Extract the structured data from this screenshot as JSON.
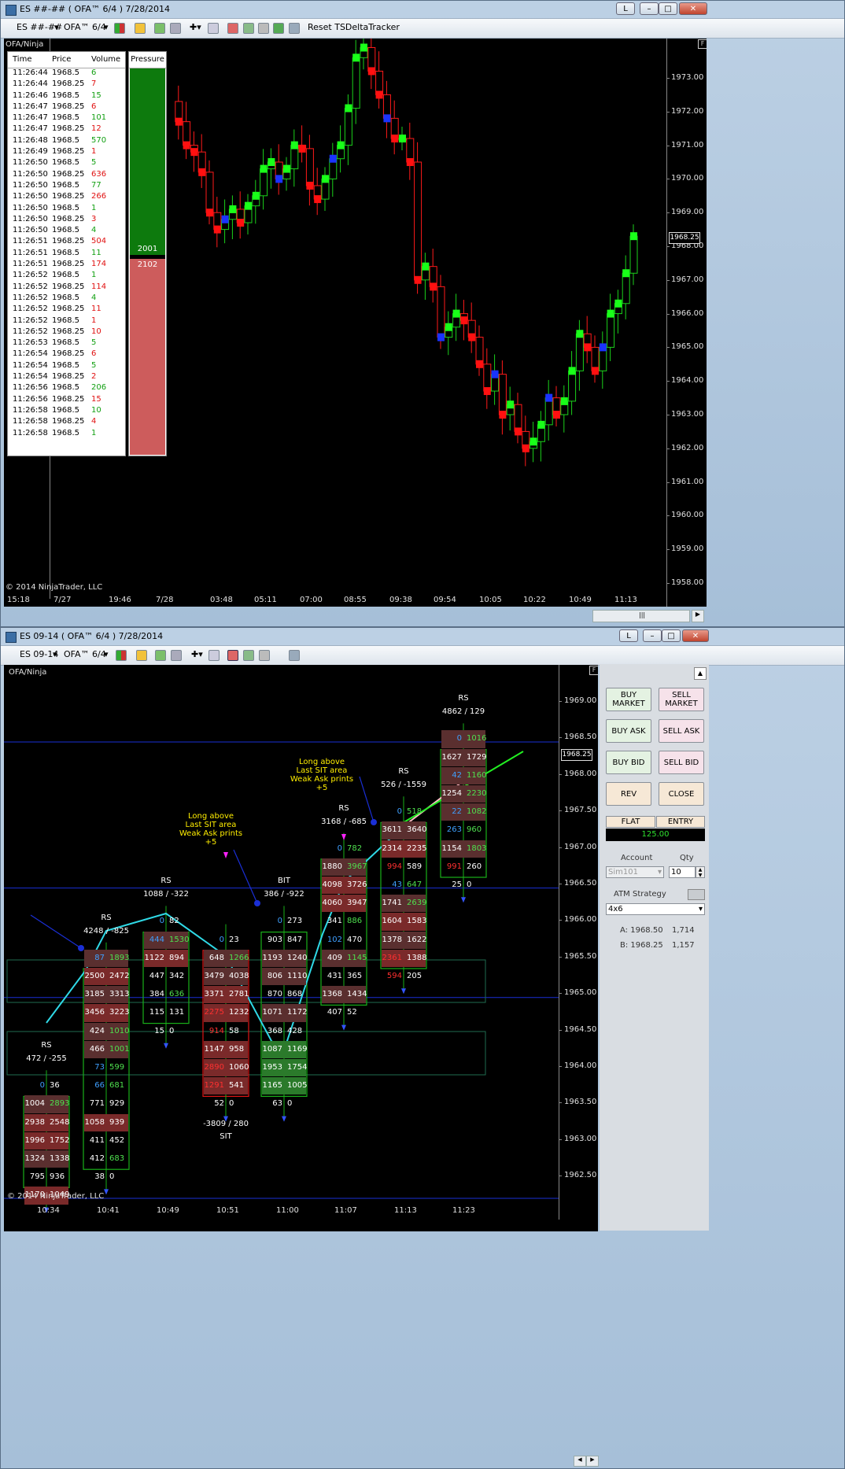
{
  "top_window": {
    "title": "ES ##-## ( OFA™ 6/4 )  7/28/2014",
    "instrument": "ES ##-##",
    "template": "OFA™ 6/4",
    "reset_label": "Reset TSDeltaTracker",
    "chart_label": "OFA/Ninja",
    "copyright": "© 2014 NinjaTrader, LLC",
    "price_marker": "1968.25",
    "f_label": "F",
    "l_label": "L",
    "tape": {
      "headers": [
        "Time",
        "Price",
        "Volume"
      ],
      "rows": [
        [
          "11:26:44",
          "1968.5",
          "6",
          "g"
        ],
        [
          "11:26:44",
          "1968.25",
          "7",
          "r"
        ],
        [
          "11:26:46",
          "1968.5",
          "15",
          "g"
        ],
        [
          "11:26:47",
          "1968.25",
          "6",
          "r"
        ],
        [
          "11:26:47",
          "1968.5",
          "101",
          "g"
        ],
        [
          "11:26:47",
          "1968.25",
          "12",
          "r"
        ],
        [
          "11:26:48",
          "1968.5",
          "570",
          "g"
        ],
        [
          "11:26:49",
          "1968.25",
          "1",
          "r"
        ],
        [
          "11:26:50",
          "1968.5",
          "5",
          "g"
        ],
        [
          "11:26:50",
          "1968.25",
          "636",
          "r"
        ],
        [
          "11:26:50",
          "1968.5",
          "77",
          "g"
        ],
        [
          "11:26:50",
          "1968.25",
          "266",
          "r"
        ],
        [
          "11:26:50",
          "1968.5",
          "1",
          "g"
        ],
        [
          "11:26:50",
          "1968.25",
          "3",
          "r"
        ],
        [
          "11:26:50",
          "1968.5",
          "4",
          "g"
        ],
        [
          "11:26:51",
          "1968.25",
          "504",
          "r"
        ],
        [
          "11:26:51",
          "1968.5",
          "11",
          "g"
        ],
        [
          "11:26:51",
          "1968.25",
          "174",
          "r"
        ],
        [
          "11:26:52",
          "1968.5",
          "1",
          "g"
        ],
        [
          "11:26:52",
          "1968.25",
          "114",
          "r"
        ],
        [
          "11:26:52",
          "1968.5",
          "4",
          "g"
        ],
        [
          "11:26:52",
          "1968.25",
          "11",
          "r"
        ],
        [
          "11:26:52",
          "1968.5",
          "1",
          "r"
        ],
        [
          "11:26:52",
          "1968.25",
          "10",
          "r"
        ],
        [
          "11:26:53",
          "1968.5",
          "5",
          "g"
        ],
        [
          "11:26:54",
          "1968.25",
          "6",
          "r"
        ],
        [
          "11:26:54",
          "1968.5",
          "5",
          "g"
        ],
        [
          "11:26:54",
          "1968.25",
          "2",
          "r"
        ],
        [
          "11:26:56",
          "1968.5",
          "206",
          "g"
        ],
        [
          "11:26:56",
          "1968.25",
          "15",
          "r"
        ],
        [
          "11:26:58",
          "1968.5",
          "10",
          "g"
        ],
        [
          "11:26:58",
          "1968.25",
          "4",
          "r"
        ],
        [
          "11:26:58",
          "1968.5",
          "1",
          "g"
        ]
      ]
    },
    "pressure": {
      "title": "Pressure",
      "buy": "2001",
      "sell": "2102",
      "buy_fraction": 0.488
    },
    "y_ticks": [
      "1973.00",
      "1972.00",
      "1971.00",
      "1970.00",
      "1969.00",
      "1968.00",
      "1967.00",
      "1966.00",
      "1965.00",
      "1964.00",
      "1963.00",
      "1962.00",
      "1961.00",
      "1960.00",
      "1959.00",
      "1958.00"
    ],
    "x_ticks": [
      "15:18",
      "7/27",
      "19:46",
      "7/28",
      "03:48",
      "05:11",
      "07:00",
      "08:55",
      "09:38",
      "09:54",
      "10:05",
      "10:22",
      "10:49",
      "11:13"
    ]
  },
  "bottom_window": {
    "title": "ES 09-14 ( OFA™ 6/4 )  7/28/2014",
    "instrument": "ES 09-14",
    "template": "OFA™ 6/4",
    "chart_label": "OFA/Ninja",
    "copyright": "© 2014 NinjaTrader, LLC",
    "price_marker": "1968.25",
    "f_label": "F",
    "l_label": "L",
    "y_ticks": [
      "1969.00",
      "1968.50",
      "1968.00",
      "1967.50",
      "1967.00",
      "1966.50",
      "1966.00",
      "1965.50",
      "1965.00",
      "1964.50",
      "1964.00",
      "1963.50",
      "1963.00",
      "1962.50"
    ],
    "x_ticks": [
      "10:34",
      "10:41",
      "10:49",
      "10:51",
      "11:00",
      "11:07",
      "11:13",
      "11:23"
    ],
    "annotations": [
      {
        "lines": [
          "Long above",
          "Last SIT area",
          "Weak Ask prints",
          "+5"
        ]
      },
      {
        "lines": [
          "Long above",
          "Last SIT area",
          "Weak Ask prints",
          "+5"
        ]
      }
    ],
    "bars": [
      {
        "tag": "RS",
        "delta": "472 / -255",
        "rows": [
          [
            "0",
            "36"
          ],
          [
            "1004",
            "2893"
          ],
          [
            "2938",
            "2548"
          ],
          [
            "1996",
            "1752"
          ],
          [
            "1324",
            "1338"
          ],
          [
            "795",
            "936"
          ],
          [
            "1170",
            "1049"
          ]
        ]
      },
      {
        "tag": "RS",
        "delta": "4248 / -825",
        "rows": [
          [
            "87",
            "1893"
          ],
          [
            "2500",
            "2472"
          ],
          [
            "3185",
            "3313"
          ],
          [
            "3456",
            "3223"
          ],
          [
            "424",
            "1010"
          ],
          [
            "466",
            "1001"
          ],
          [
            "73",
            "599"
          ],
          [
            "66",
            "681"
          ],
          [
            "771",
            "929"
          ],
          [
            "1058",
            "939"
          ],
          [
            "411",
            "452"
          ],
          [
            "412",
            "683"
          ],
          [
            "38",
            "0"
          ]
        ]
      },
      {
        "tag": "RS",
        "delta": "1088 / -322",
        "rows": [
          [
            "0",
            "82"
          ],
          [
            "444",
            "1530"
          ],
          [
            "1122",
            "894"
          ],
          [
            "447",
            "342"
          ],
          [
            "384",
            "636"
          ],
          [
            "115",
            "131"
          ],
          [
            "15",
            "0"
          ]
        ]
      },
      {
        "tag": "",
        "delta": "",
        "rows": [
          [
            "0",
            "23"
          ],
          [
            "648",
            "1266"
          ],
          [
            "3479",
            "4038"
          ],
          [
            "3371",
            "2781"
          ],
          [
            "2275",
            "1232"
          ],
          [
            "914",
            "58"
          ],
          [
            "1147",
            "958"
          ],
          [
            "2890",
            "1060"
          ],
          [
            "1291",
            "541"
          ],
          [
            "52",
            "0"
          ]
        ],
        "foot": "-3809 / 280",
        "foot_tag": "SIT"
      },
      {
        "tag": "BIT",
        "delta": "386 / -922",
        "rows": [
          [
            "0",
            "273"
          ],
          [
            "903",
            "847"
          ],
          [
            "1193",
            "1240"
          ],
          [
            "806",
            "1110"
          ],
          [
            "870",
            "868"
          ],
          [
            "1071",
            "1172"
          ],
          [
            "368",
            "428"
          ],
          [
            "1087",
            "1169"
          ],
          [
            "1953",
            "1754"
          ],
          [
            "1165",
            "1005"
          ],
          [
            "63",
            "0"
          ]
        ]
      },
      {
        "tag": "RS",
        "delta": "3168 / -685",
        "rows": [
          [
            "0",
            "782"
          ],
          [
            "1880",
            "3967"
          ],
          [
            "4098",
            "3726"
          ],
          [
            "4060",
            "3947"
          ],
          [
            "341",
            "886"
          ],
          [
            "102",
            "470"
          ],
          [
            "409",
            "1145"
          ],
          [
            "431",
            "365"
          ],
          [
            "1368",
            "1434"
          ],
          [
            "407",
            "52"
          ]
        ]
      },
      {
        "tag": "RS",
        "delta": "526 / -1559",
        "rows": [
          [
            "0",
            "518"
          ],
          [
            "3611",
            "3640"
          ],
          [
            "2314",
            "2235"
          ],
          [
            "994",
            "589"
          ],
          [
            "43",
            "647"
          ],
          [
            "1741",
            "2639"
          ],
          [
            "1604",
            "1583"
          ],
          [
            "1378",
            "1622"
          ],
          [
            "2361",
            "1388"
          ],
          [
            "594",
            "205"
          ]
        ]
      },
      {
        "tag": "RS",
        "delta": "4862 / 129",
        "rows": [
          [
            "0",
            "1016"
          ],
          [
            "1627",
            "1729"
          ],
          [
            "42",
            "1160"
          ],
          [
            "1254",
            "2230"
          ],
          [
            "22",
            "1082"
          ],
          [
            "263",
            "960"
          ],
          [
            "1154",
            "1803"
          ],
          [
            "991",
            "260"
          ],
          [
            "25",
            "0"
          ]
        ]
      }
    ],
    "panel": {
      "buy_market": "BUY MARKET",
      "sell_market": "SELL MARKET",
      "buy_ask": "BUY ASK",
      "sell_ask": "SELL ASK",
      "buy_bid": "BUY BID",
      "sell_bid": "SELL BID",
      "rev": "REV",
      "close": "CLOSE",
      "flat": "FLAT",
      "entry": "ENTRY",
      "pnl": "125.00",
      "account_label": "Account",
      "account": "Sim101",
      "qty_label": "Qty",
      "qty": "10",
      "atm_label": "ATM Strategy",
      "atm": "4x6",
      "ask_label": "A: 1968.50",
      "ask_size": "1,714",
      "bid_label": "B: 1968.25",
      "bid_size": "1,157"
    }
  }
}
